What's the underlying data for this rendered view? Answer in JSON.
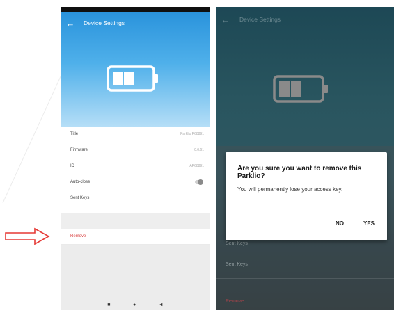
{
  "left_screen": {
    "app_bar": {
      "title": "Device Settings",
      "back_icon": "arrow-left-icon"
    },
    "battery_icon": "battery-icon",
    "rows": [
      {
        "label": "Title",
        "value": "Parklio P68891"
      },
      {
        "label": "Firmware",
        "value": "0.0.61"
      },
      {
        "label": "ID",
        "value": "AP68891"
      },
      {
        "label": "Auto-close",
        "value": ""
      },
      {
        "label": "Sent Keys",
        "value": ""
      }
    ],
    "remove_label": "Remove",
    "nav": {
      "square": "■",
      "circle": "●",
      "back": "◄"
    }
  },
  "right_screen": {
    "app_bar": {
      "title": "Device Settings",
      "back_icon": "arrow-left-icon"
    },
    "background_rows": {
      "partial_label": "Sent Keys",
      "sent_keys": "Sent Keys",
      "remove": "Remove"
    },
    "dialog": {
      "title": "Are you sure you want to remove this Parklio?",
      "message": "You will permanently lose your access key.",
      "no_label": "NO",
      "yes_label": "YES"
    }
  },
  "colors": {
    "header_blue": "#2a93dc",
    "remove_red": "#d83c3c",
    "overlay_teal": "#29555f",
    "arrow_red": "#e53935"
  }
}
